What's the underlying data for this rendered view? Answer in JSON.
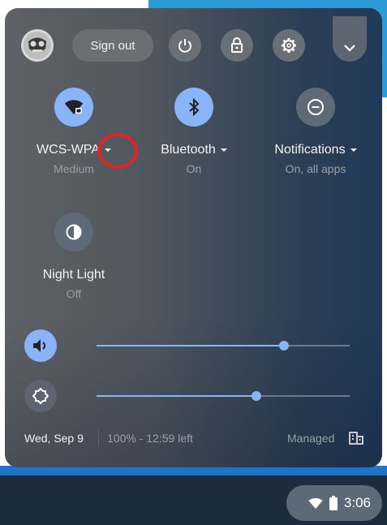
{
  "header": {
    "sign_out_label": "Sign out"
  },
  "tiles": {
    "network": {
      "label": "WCS-WPA",
      "sub": "Medium",
      "state": "on"
    },
    "bluetooth": {
      "label": "Bluetooth",
      "sub": "On",
      "state": "on"
    },
    "notifications": {
      "label": "Notifications",
      "sub": "On, all apps",
      "state": "off"
    },
    "night_light": {
      "label": "Night Light",
      "sub": "Off",
      "state": "off"
    }
  },
  "sliders": {
    "volume": {
      "level": 0.74
    },
    "brightness": {
      "level": 0.63
    }
  },
  "footer": {
    "date": "Wed, Sep 9",
    "battery": "100% - 12:59 left",
    "managed": "Managed"
  },
  "shelf": {
    "time": "3:06"
  },
  "colors": {
    "accent": "#8ab4f8",
    "highlight_ring": "#e02525"
  },
  "icons": [
    "avatar-icon",
    "power-icon",
    "lock-icon",
    "gear-icon",
    "chevron-down-icon",
    "wifi-icon",
    "bluetooth-icon",
    "do-not-disturb-icon",
    "night-light-icon",
    "volume-icon",
    "brightness-icon",
    "managed-icon",
    "battery-icon"
  ]
}
